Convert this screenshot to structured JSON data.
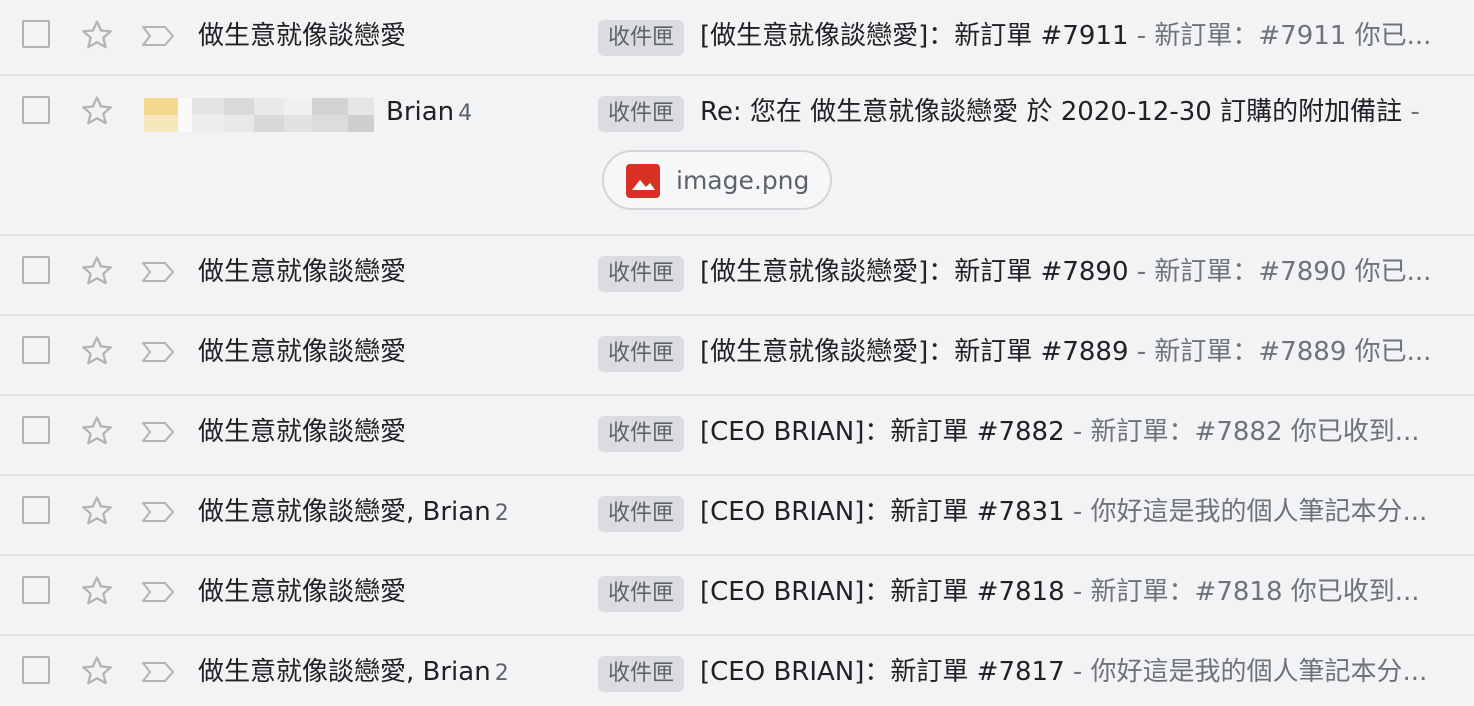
{
  "label_text": "收件匣",
  "rows": [
    {
      "sender": "做生意就像談戀愛",
      "count": "",
      "subject": "[做生意就像談戀愛]：新訂單 #7911",
      "snippet": " - 新訂單：#7911 你已..."
    },
    {
      "sender": "Brian",
      "count": "4",
      "subject": "Re: 您在 做生意就像談戀愛 於 2020-12-30 訂購的附加備註",
      "snippet": " -",
      "attachment": "image.png",
      "attachment_icon": "image-file-icon"
    },
    {
      "sender": "做生意就像談戀愛",
      "count": "",
      "subject": "[做生意就像談戀愛]：新訂單 #7890",
      "snippet": " - 新訂單：#7890 你已..."
    },
    {
      "sender": "做生意就像談戀愛",
      "count": "",
      "subject": "[做生意就像談戀愛]：新訂單 #7889",
      "snippet": " - 新訂單：#7889 你已..."
    },
    {
      "sender": "做生意就像談戀愛",
      "count": "",
      "subject": "[CEO BRIAN]：新訂單 #7882",
      "snippet": " - 新訂單：#7882 你已收到..."
    },
    {
      "sender": "做生意就像談戀愛, Brian",
      "count": "2",
      "subject": "[CEO BRIAN]：新訂單 #7831",
      "snippet": " - 你好這是我的個人筆記本分..."
    },
    {
      "sender": "做生意就像談戀愛",
      "count": "",
      "subject": "[CEO BRIAN]：新訂單 #7818",
      "snippet": " - 新訂單：#7818 你已收到..."
    },
    {
      "sender": "做生意就像談戀愛, Brian",
      "count": "2",
      "subject": "[CEO BRIAN]：新訂單 #7817",
      "snippet": " - 你好這是我的個人筆記本分..."
    }
  ],
  "colors": {
    "background": "#f2f3f4",
    "label_bg": "#dadce0",
    "attachment_icon": "#d93025"
  }
}
